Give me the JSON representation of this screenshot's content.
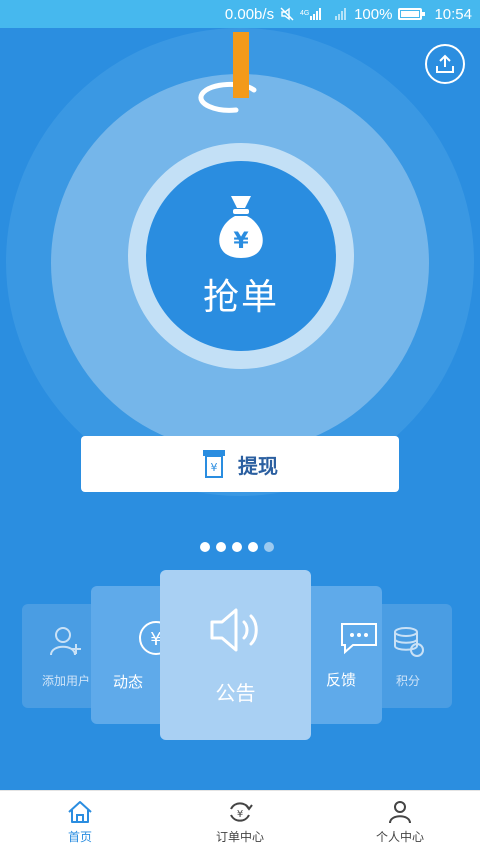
{
  "status_bar": {
    "speed": "0.00b/s",
    "network": "4G",
    "battery": "100%",
    "time": "10:54"
  },
  "hero": {
    "grab_label": "抢单",
    "money_icon": "money-bag-icon"
  },
  "withdraw": {
    "label": "提现",
    "icon": "atm-card-icon"
  },
  "carousel": {
    "active_index": 5,
    "cards": [
      {
        "label": "添加用户",
        "icon": "add-user-icon"
      },
      {
        "label": "动态",
        "icon": "yuan-circle-icon"
      },
      {
        "label": "公告",
        "icon": "speaker-icon"
      },
      {
        "label": "反馈",
        "icon": "chat-bubble-icon"
      },
      {
        "label": "积分",
        "icon": "coins-stack-icon"
      }
    ]
  },
  "tabs": [
    {
      "label": "首页",
      "icon": "home-icon",
      "active": true
    },
    {
      "label": "订单中心",
      "icon": "order-cycle-icon",
      "active": false
    },
    {
      "label": "个人中心",
      "icon": "person-icon",
      "active": false
    }
  ],
  "colors": {
    "background": "#2b8ee0",
    "status_bar": "#46b8ee",
    "needle": "#f39a1a",
    "active_tab": "#2a8de0"
  }
}
